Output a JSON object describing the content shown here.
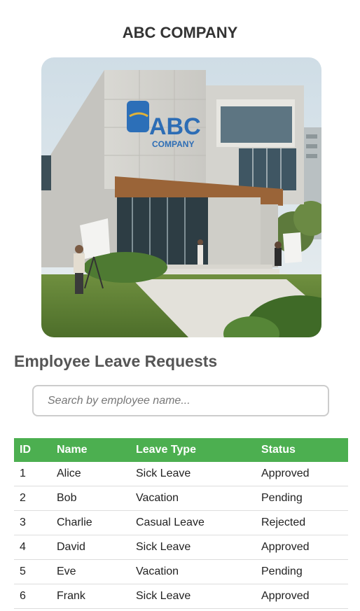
{
  "header": {
    "company_name": "ABC COMPANY"
  },
  "hero": {
    "logo_text": "ABC",
    "logo_subtext": "COMPANY"
  },
  "section": {
    "title": "Employee Leave Requests"
  },
  "search": {
    "placeholder": "Search by employee name...",
    "value": ""
  },
  "table": {
    "headers": [
      "ID",
      "Name",
      "Leave Type",
      "Status"
    ],
    "rows": [
      {
        "id": "1",
        "name": "Alice",
        "type": "Sick Leave",
        "status": "Approved"
      },
      {
        "id": "2",
        "name": "Bob",
        "type": "Vacation",
        "status": "Pending"
      },
      {
        "id": "3",
        "name": "Charlie",
        "type": "Casual Leave",
        "status": "Rejected"
      },
      {
        "id": "4",
        "name": "David",
        "type": "Sick Leave",
        "status": "Approved"
      },
      {
        "id": "5",
        "name": "Eve",
        "type": "Vacation",
        "status": "Pending"
      },
      {
        "id": "6",
        "name": "Frank",
        "type": "Sick Leave",
        "status": "Approved"
      }
    ]
  },
  "colors": {
    "header_green": "#4caf50",
    "title_text": "#333333",
    "section_text": "#555555"
  }
}
